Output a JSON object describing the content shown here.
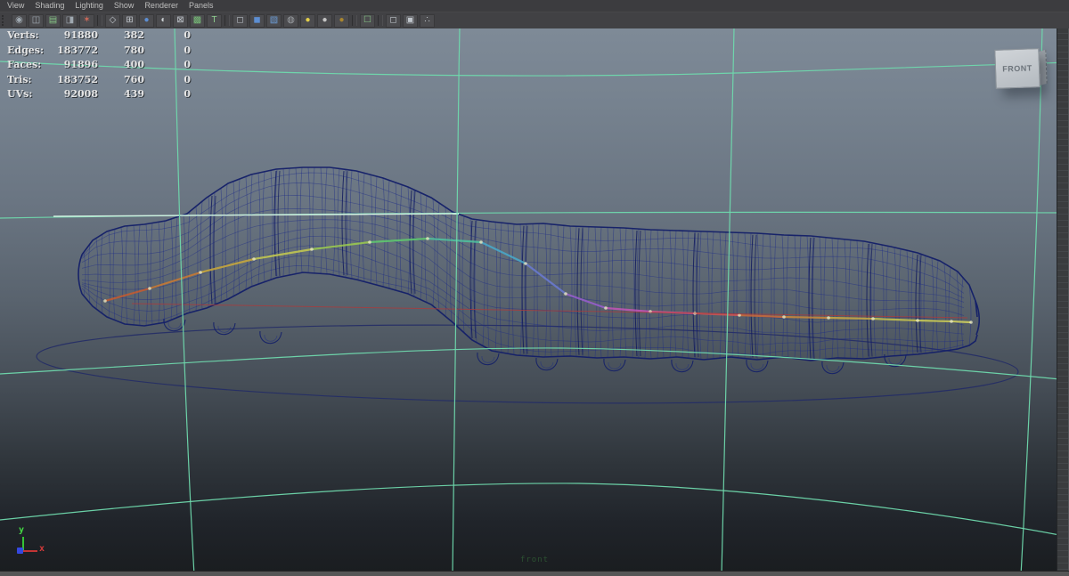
{
  "menubar": {
    "items": [
      "View",
      "Shading",
      "Lighting",
      "Show",
      "Renderer",
      "Panels"
    ]
  },
  "toolbar": {
    "icons": [
      {
        "name": "select-camera-icon",
        "glyph": "◉",
        "color": "#9fa8b0"
      },
      {
        "name": "camera-attributes-icon",
        "glyph": "◫",
        "color": "#9fa8b0"
      },
      {
        "name": "bookmarks-icon",
        "glyph": "▤",
        "color": "#86c586"
      },
      {
        "name": "image-plane-icon",
        "glyph": "◨",
        "color": "#9fa8b0"
      },
      {
        "name": "pan-zoom-icon",
        "glyph": "✶",
        "color": "#d06a5a"
      },
      {
        "sep": true
      },
      {
        "name": "wireframe-icon",
        "glyph": "◇",
        "color": "#c0c6cc"
      },
      {
        "name": "film-gate-icon",
        "glyph": "⊞",
        "color": "#c0c6cc"
      },
      {
        "name": "smooth-shade-icon",
        "glyph": "●",
        "color": "#5d8ed2"
      },
      {
        "name": "specular-shade-icon",
        "glyph": "◐",
        "color": "#cdd2d6"
      },
      {
        "name": "xray-icon",
        "glyph": "⊠",
        "color": "#c0c6cc"
      },
      {
        "name": "xray-joints-icon",
        "glyph": "▩",
        "color": "#79c079"
      },
      {
        "name": "textured-icon",
        "glyph": "T",
        "color": "#8fd08f"
      },
      {
        "sep": true
      },
      {
        "name": "default-material-icon",
        "glyph": "◻",
        "color": "#b8bec4"
      },
      {
        "name": "shaded-cube-icon",
        "glyph": "◼",
        "color": "#5d8ed2"
      },
      {
        "name": "transparent-cube-icon",
        "glyph": "▧",
        "color": "#6d9ed8"
      },
      {
        "name": "checker-sphere-icon",
        "glyph": "◍",
        "color": "#a0a4a8"
      },
      {
        "name": "all-lights-icon",
        "glyph": "●",
        "color": "#e3cf4a"
      },
      {
        "name": "flat-light-icon",
        "glyph": "●",
        "color": "#c4c4c4"
      },
      {
        "name": "default-light-icon",
        "glyph": "●",
        "color": "#a9862f"
      },
      {
        "sep": true
      },
      {
        "name": "isolate-select-icon",
        "glyph": "☐",
        "color": "#86c586"
      },
      {
        "sep": true
      },
      {
        "name": "plain-cube-icon",
        "glyph": "◻",
        "color": "#c0c6cc"
      },
      {
        "name": "frame-icon",
        "glyph": "▣",
        "color": "#c0c6cc"
      },
      {
        "name": "share-node-icon",
        "glyph": "∴",
        "color": "#c0c6cc"
      }
    ]
  },
  "hud": {
    "rows": [
      {
        "label": "Verts:",
        "col1": "91880",
        "col2": "382",
        "col3": "0"
      },
      {
        "label": "Edges:",
        "col1": "183772",
        "col2": "780",
        "col3": "0"
      },
      {
        "label": "Faces:",
        "col1": "91896",
        "col2": "400",
        "col3": "0"
      },
      {
        "label": "Tris:",
        "col1": "183752",
        "col2": "760",
        "col3": "0"
      },
      {
        "label": "UVs:",
        "col1": "92008",
        "col2": "439",
        "col3": "0"
      }
    ]
  },
  "view_cube": {
    "label": "FRONT"
  },
  "axis_gizmo": {
    "y_label": "y",
    "x_label": "x"
  },
  "camera_label": "front",
  "colors": {
    "grid": "#6fd9ad",
    "grid_bright": "#d8f4e6",
    "wire": "#1d2b87",
    "wire_dark": "#131f68",
    "seam": "#101a5e",
    "ellipse": "#232c66",
    "red_line": "#b03838"
  }
}
